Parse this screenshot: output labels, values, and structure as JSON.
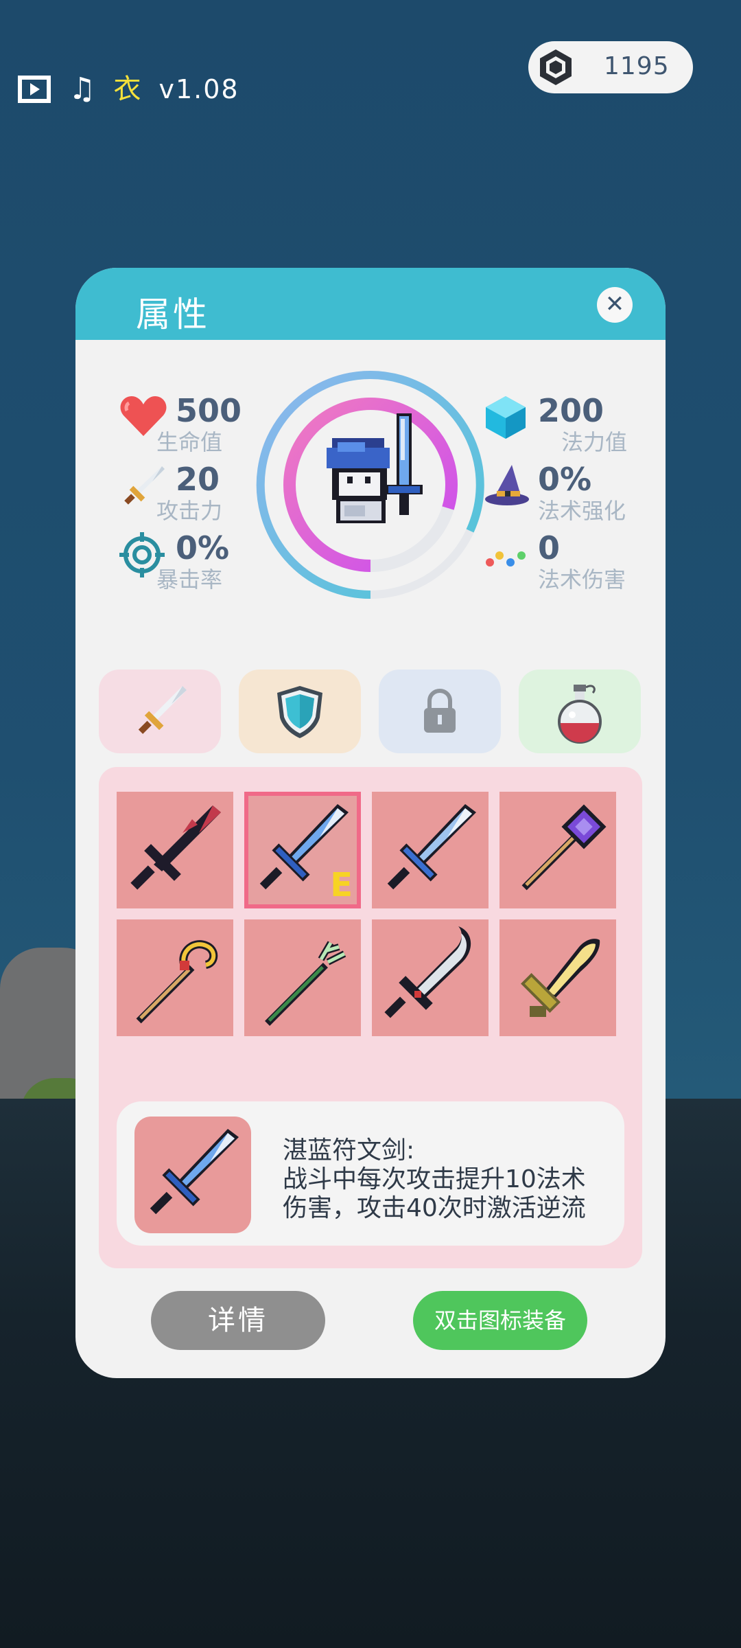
{
  "topbar": {
    "video_icon": "film-icon",
    "music_icon": "music-icon",
    "music_glyph": "♫",
    "clothes_label": "衣",
    "version": "v1.08"
  },
  "currency": {
    "icon": "gem-icon",
    "amount": "1195"
  },
  "dialog": {
    "title": "属性",
    "close_glyph": "✕",
    "stats_left": [
      {
        "icon": "heart-icon",
        "value": "500",
        "label": "生命值"
      },
      {
        "icon": "sword-icon",
        "value": "20",
        "label": "攻击力"
      },
      {
        "icon": "target-icon",
        "value": "0%",
        "label": "暴击率"
      }
    ],
    "stats_right": [
      {
        "icon": "mana-crystal-icon",
        "value": "200",
        "label": "法力值"
      },
      {
        "icon": "wizard-hat-icon",
        "value": "0%",
        "label": "法术强化"
      },
      {
        "icon": "orbs-icon",
        "value": "0",
        "label": "法术伤害"
      }
    ],
    "tabs": [
      {
        "name": "weapon",
        "icon": "sword-icon",
        "bg": "#f6dde4"
      },
      {
        "name": "armor",
        "icon": "shield-icon",
        "bg": "#f6e6d2"
      },
      {
        "name": "locked",
        "icon": "lock-icon",
        "bg": "#dfe7f3"
      },
      {
        "name": "potion",
        "icon": "potion-icon",
        "bg": "#def3df"
      }
    ],
    "inventory": {
      "items": [
        {
          "icon": "dark-blade-icon"
        },
        {
          "icon": "azure-rune-sword-icon",
          "selected": true,
          "equipped_mark": "E"
        },
        {
          "icon": "blue-sword-icon"
        },
        {
          "icon": "purple-staff-icon"
        },
        {
          "icon": "golden-staff-icon"
        },
        {
          "icon": "green-staff-icon"
        },
        {
          "icon": "scimitar-icon"
        },
        {
          "icon": "golden-blade-icon"
        }
      ]
    },
    "description": {
      "title": "湛蓝符文剑:",
      "line1": "战斗中每次攻击提升10法术",
      "line2": "伤害，攻击40次时激活逆流"
    },
    "buttons": {
      "detail": "详情",
      "equip": "双击图标装备"
    }
  },
  "colors": {
    "header": "#3fbcd0",
    "accent_green": "#4fc65c",
    "slot": "#e89a9a",
    "selected_outline": "#f06a88"
  }
}
